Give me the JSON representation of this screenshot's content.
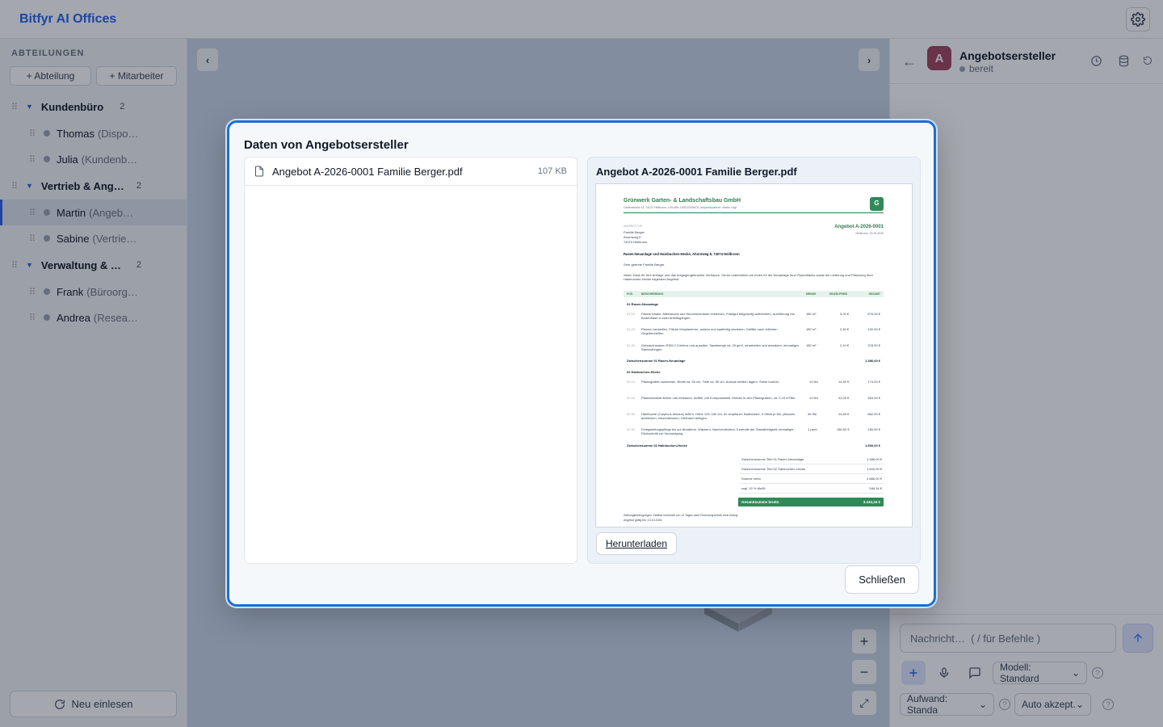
{
  "app": {
    "title": "Bitfyr AI Offices"
  },
  "sidebar": {
    "section_title": "ABTEILUNGEN",
    "add_department_label": "+ Abteilung",
    "add_employee_label": "+ Mitarbeiter",
    "departments": [
      {
        "name": "Kundenbüro",
        "count": "2",
        "employees": [
          {
            "name": "Thomas",
            "role": "(Dispo…"
          },
          {
            "name": "Julia",
            "role": "(Kundenb…"
          }
        ]
      },
      {
        "name": "Vertrieb & Ange…",
        "count": "2",
        "employees": [
          {
            "name": "Martin",
            "role": "(Angeb…"
          },
          {
            "name": "Sabine",
            "role": "(Vertrie…"
          }
        ]
      },
      {
        "name": "Verwaltung & W…",
        "count": "2",
        "employees": [
          {
            "name": "Frank",
            "role": "(Büroorg…"
          },
          {
            "name": "Andrea",
            "role": "(Resea…"
          }
        ]
      }
    ],
    "reload_label": "Neu einlesen"
  },
  "canvas": {
    "prev_label": "‹",
    "next_label": "›",
    "zoom_in_label": "+",
    "zoom_out_label": "−",
    "fit_label": "⤢"
  },
  "chat": {
    "agent_initial": "A",
    "agent_name": "Angebotsersteller",
    "agent_status": "bereit",
    "input_placeholder": "Nachricht…  ( / für Befehle )",
    "model_select": "Modell: Standard",
    "effort_select": "Aufwand: Standa",
    "accept_select": "Auto akzept."
  },
  "modal": {
    "title": "Daten von Angebotsersteller",
    "files": [
      {
        "name": "Angebot A-2026-0001 Familie Berger.pdf",
        "size": "107 KB"
      }
    ],
    "preview_title": "Angebot A-2026-0001 Familie Berger.pdf",
    "download_label": "Herunterladen",
    "close_label": "Schließen"
  },
  "pdf": {
    "company": "Grünwerk Garten- & Landschaftsbau GmbH",
    "company_sub": "Gartenstraße 14, 74072 Heilbronn, USt-IdNr. DE812345678, Ansprechpartner: Martin Vogt",
    "logo": "G",
    "recipient_label": "ANGEBOT FÜR",
    "recipient_lines": [
      "Familie Berger",
      "Ahornweg 8",
      "74074 Heilbronn"
    ],
    "offer_number": "Angebot A-2026-0001",
    "offer_place_date": "Heilbronn, 13.09.2026",
    "subject": "Rasen-Neuanlage und Hainbuchen-Hecke, Ahornweg 8, 74074 Heilbronn",
    "salutation": "Sehr geehrte Familie Berger,",
    "intro": "vielen Dank für Ihre Anfrage und das entgegengebrachte Vertrauen. Gerne unterbreiten wir Ihnen für die Neuanlage Ihrer Rasenfläche sowie die Lieferung und Pflanzung Ihrer Hainbuchen-Hecke folgendes Angebot.",
    "table_headers": [
      "POS.",
      "BESCHREIBUNG",
      "MENGE",
      "EINZELPREIS",
      "GESAMT"
    ],
    "groups": [
      {
        "title": "01   Rasen-Neuanlage",
        "rows": [
          {
            "pos": "01.10",
            "desc": "Fläche fräsen, Altbewuchs und Wurzelunkräuter entfernen, Frästgut tiefgründig aufbereiten, Ausführung mit Bodenfräse in zwei Arbeitsgängen.",
            "qty": "180 m²",
            "unit": "3,20 €",
            "total": "576,00 €"
          },
          {
            "pos": "01.20",
            "desc": "Planum herstellen, Fläche feinplanieren, walzen und saatfertig abziehen, Gefälle nach örtlichen Gegebenheiten.",
            "qty": "180 m²",
            "unit": "2,40 €",
            "total": "432,00 €"
          },
          {
            "pos": "01.30",
            "desc": "Gebrauchsrasen RSM 2.3 liefern und aussäen, Saatmenge ca. 25 g/m², einarbeiten und anwalzen, einmaliges Starterdüngen.",
            "qty": "180 m²",
            "unit": "2,10 €",
            "total": "378,00 €"
          }
        ],
        "subtotal_label": "Zwischensumme 01 Rasen-Neuanlage",
        "subtotal": "1.386,00 €"
      },
      {
        "title": "02   Hainbuchen-Hecke",
        "rows": [
          {
            "pos": "02.10",
            "desc": "Pflanzgraben ausheben, Breite ca. 50 cm, Tiefe ca. 50 cm, Aushub seitlich lagern, Sohle lockern.",
            "qty": "12 lfm",
            "unit": "14,50 €",
            "total": "174,00 €"
          },
          {
            "pos": "02.20",
            "desc": "Pflanzsubstrat liefern und einbauen, torffrei, mit Kompostanteil, Einbau in den Pflanzgraben, ca. 0,15 m³/lfm.",
            "qty": "12 lfm",
            "unit": "22,00 €",
            "total": "264,00 €"
          },
          {
            "pos": "02.30",
            "desc": "Hainbuche (Carpinus betulus) liefern, Höhe 125–150 cm, 3x verpflanzt, Ballenware, 3 Stück je lfm, pflanzen, andrücken, einschlämmen, Gießrand anlegen.",
            "qty": "36 Stk",
            "unit": "24,50 €",
            "total": "882,00 €"
          },
          {
            "pos": "02.40",
            "desc": "Fertigstellungspflege bis zur Abnahme: Wässern, Nachverdichten, Kontrolle der Standfestigkeit, einmaliger Rückschnitt zur Verzweigung.",
            "qty": "1 psch",
            "unit": "180,00 €",
            "total": "180,00 €"
          }
        ],
        "subtotal_label": "Zwischensumme 02 Hainbuchen-Hecke",
        "subtotal": "1.500,00 €"
      }
    ],
    "summary": [
      {
        "label": "Zwischensumme Titel 01 Rasen-Neuanlage",
        "value": "1.386,00 €"
      },
      {
        "label": "Zwischensumme Titel 02 Hainbuchen-Hecke",
        "value": "1.500,00 €"
      },
      {
        "label": "Summe netto",
        "value": "2.886,00 €"
      },
      {
        "label": "zzgl. 19 % MwSt",
        "value": "548,34 €"
      }
    ],
    "grand_total_label": "Gesamtsumme brutto",
    "grand_total": "3.434,34 €",
    "footer_1": "Zahlungsbedingungen: Zahlbar innerhalb von 14 Tagen nach Rechnungserhalt ohne Abzug.",
    "footer_2": "Angebot gültig bis: 13.10.2026."
  },
  "colors": {
    "accent": "#2563eb",
    "modal_border": "#1d6fd1",
    "pdf_green": "#2f7d4f",
    "avatar": "#a0445d"
  }
}
